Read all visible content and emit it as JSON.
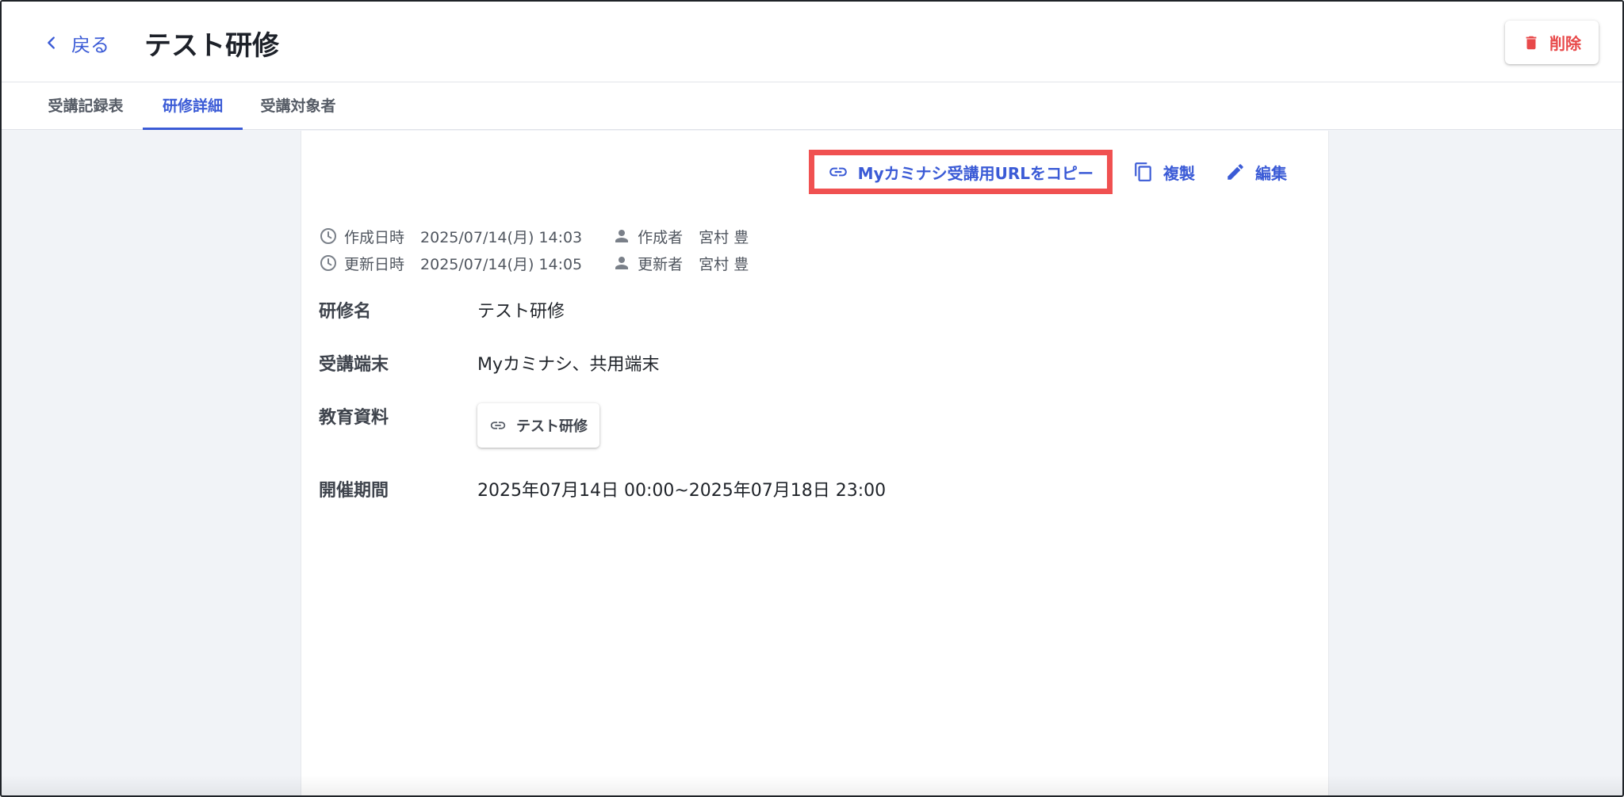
{
  "header": {
    "back_label": "戻る",
    "title": "テスト研修",
    "delete_label": "削除"
  },
  "tabs": [
    {
      "label": "受講記録表",
      "active": false
    },
    {
      "label": "研修詳細",
      "active": true
    },
    {
      "label": "受講対象者",
      "active": false
    }
  ],
  "actions": {
    "copy_url_label": "Myカミナシ受講用URLをコピー",
    "duplicate_label": "複製",
    "edit_label": "編集"
  },
  "meta": {
    "created_label": "作成日時",
    "created_at": "2025/07/14(月) 14:03",
    "creator_label": "作成者",
    "creator": "宮村 豊",
    "updated_label": "更新日時",
    "updated_at": "2025/07/14(月) 14:05",
    "updater_label": "更新者",
    "updater": "宮村 豊"
  },
  "fields": {
    "name_label": "研修名",
    "name_value": "テスト研修",
    "device_label": "受講端末",
    "device_value": "Myカミナシ、共用端末",
    "material_label": "教育資料",
    "material_value": "テスト研修",
    "period_label": "開催期間",
    "period_value": "2025年07月14日 00:00~2025年07月18日 23:00"
  },
  "colors": {
    "accent": "#3b5bd6",
    "danger": "#e8494a",
    "highlight": "#f05151"
  },
  "icons": {
    "back": "chevron-left-icon",
    "delete": "trash-icon",
    "copy_url": "link-icon",
    "duplicate": "copy-icon",
    "edit": "pencil-icon",
    "time": "clock-icon",
    "person": "person-icon",
    "material": "link-icon"
  }
}
